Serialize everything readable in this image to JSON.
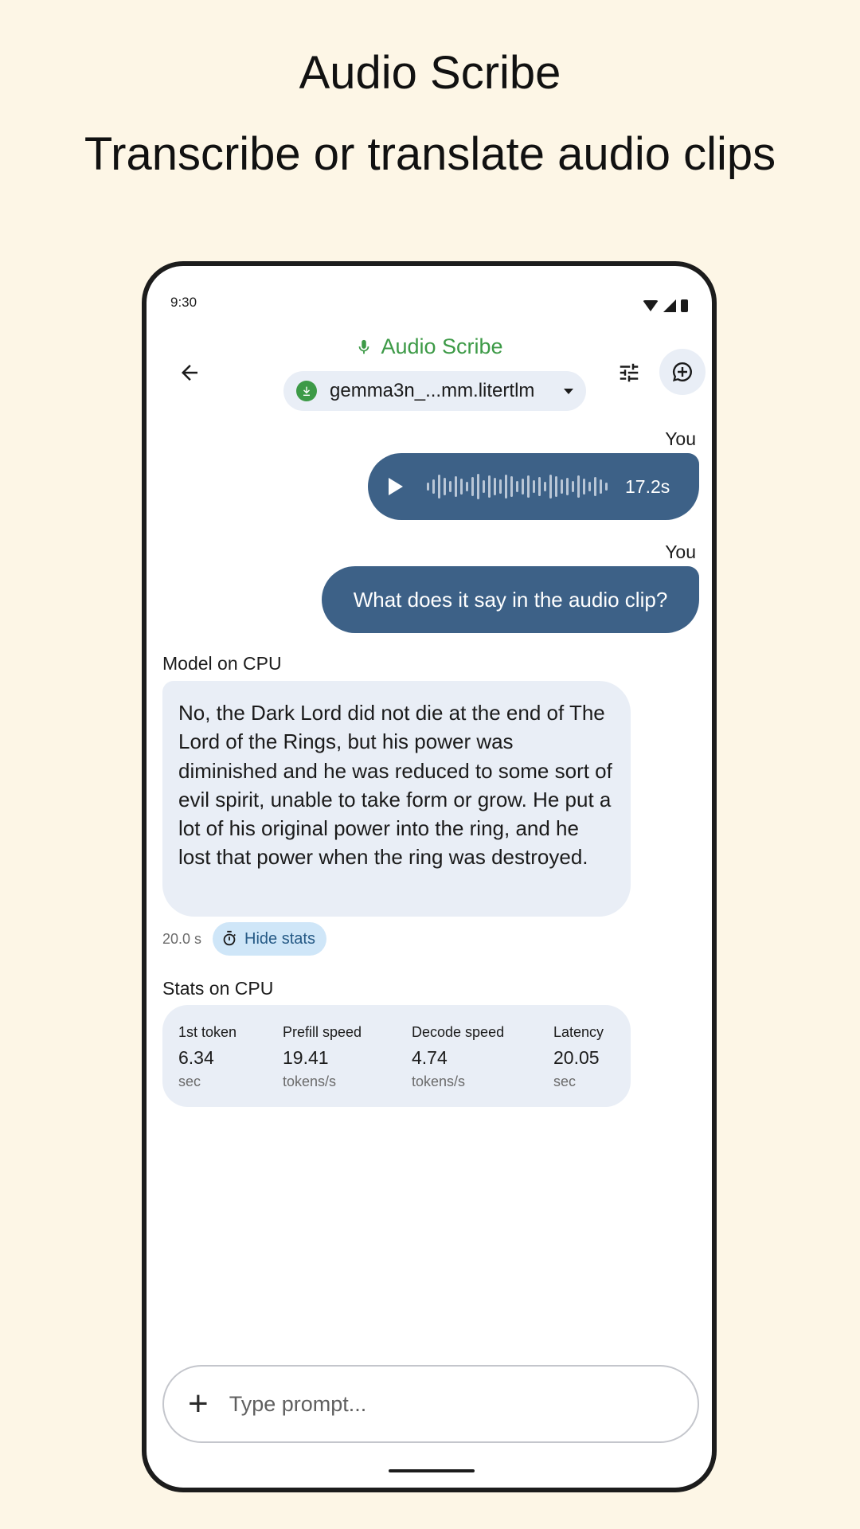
{
  "promo": {
    "title": "Audio Scribe",
    "subtitle": "Transcribe or translate audio clips"
  },
  "status_bar": {
    "time": "9:30"
  },
  "app_bar": {
    "title": "Audio Scribe",
    "model_name": "gemma3n_...mm.litertlm",
    "accent_color": "#3d9a47"
  },
  "messages": {
    "audio": {
      "sender": "You",
      "duration": "17.2s"
    },
    "user_text": {
      "sender": "You",
      "text": "What does it say in the audio clip?"
    },
    "model": {
      "sender": "Model on CPU",
      "text": "No, the Dark Lord did not die at the end of The Lord of the Rings, but his power was diminished and he was reduced to some sort of evil spirit, unable to take form or grow. He put a lot of his original power into the ring, and he lost that power when the ring was destroyed.",
      "latency": "20.0 s",
      "hide_stats_label": "Hide stats"
    }
  },
  "stats": {
    "title": "Stats on CPU",
    "items": [
      {
        "label": "1st token",
        "value": "6.34",
        "unit": "sec"
      },
      {
        "label": "Prefill speed",
        "value": "19.41",
        "unit": "tokens/s"
      },
      {
        "label": "Decode speed",
        "value": "4.74",
        "unit": "tokens/s"
      },
      {
        "label": "Latency",
        "value": "20.05",
        "unit": "sec"
      }
    ]
  },
  "prompt": {
    "placeholder": "Type prompt..."
  },
  "colors": {
    "user_bubble": "#3d6187",
    "model_bubble": "#e9eef6",
    "background": "#fdf6e6"
  }
}
